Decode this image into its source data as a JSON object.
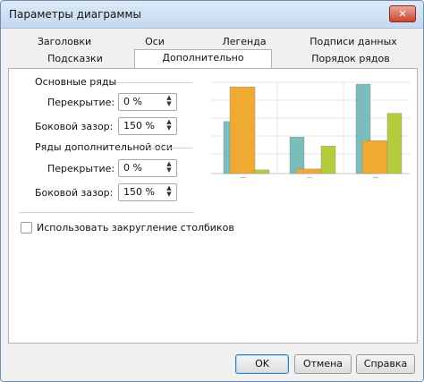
{
  "window": {
    "title": "Параметры диаграммы",
    "close_glyph": "✕"
  },
  "tabs_top": [
    "Заголовки",
    "Оси",
    "Легенда",
    "Подписи данных"
  ],
  "tabs_bottom": [
    "Подсказки",
    "Дополнительно",
    "Порядок рядов"
  ],
  "active_tab": "Дополнительно",
  "primary": {
    "heading": "Основные ряды",
    "overlap_label": "Перекрытие:",
    "overlap_value": "0 %",
    "gap_label": "Боковой зазор:",
    "gap_value": "150 %"
  },
  "secondary": {
    "heading": "Ряды дополнительной оси",
    "overlap_label": "Перекрытие:",
    "overlap_value": "0 %",
    "gap_label": "Боковой зазор:",
    "gap_value": "150 %"
  },
  "rounding": {
    "label": "Использовать закругление столбиков",
    "checked": false
  },
  "spinner_arrows": {
    "up": "▲",
    "down": "▼"
  },
  "buttons": {
    "ok": "OK",
    "cancel": "Отмена",
    "help": "Справка"
  },
  "preview_chart": {
    "colors": {
      "teal": "#7bbcbc",
      "orange": "#f0aa32",
      "green": "#b5cc3c"
    },
    "groups": [
      {
        "teal": 0.57,
        "orange": 0.95,
        "green": 0.04
      },
      {
        "teal": 0.4,
        "orange": 0.05,
        "green": 0.3
      },
      {
        "teal": 0.98,
        "orange": 0.36,
        "green": 0.66
      }
    ]
  }
}
